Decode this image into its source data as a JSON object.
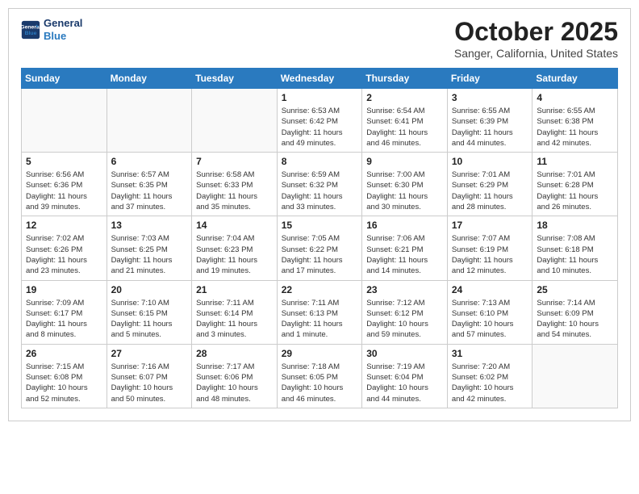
{
  "header": {
    "logo_line1": "General",
    "logo_line2": "Blue",
    "month": "October 2025",
    "location": "Sanger, California, United States"
  },
  "weekdays": [
    "Sunday",
    "Monday",
    "Tuesday",
    "Wednesday",
    "Thursday",
    "Friday",
    "Saturday"
  ],
  "weeks": [
    [
      {
        "day": "",
        "info": ""
      },
      {
        "day": "",
        "info": ""
      },
      {
        "day": "",
        "info": ""
      },
      {
        "day": "1",
        "info": "Sunrise: 6:53 AM\nSunset: 6:42 PM\nDaylight: 11 hours\nand 49 minutes."
      },
      {
        "day": "2",
        "info": "Sunrise: 6:54 AM\nSunset: 6:41 PM\nDaylight: 11 hours\nand 46 minutes."
      },
      {
        "day": "3",
        "info": "Sunrise: 6:55 AM\nSunset: 6:39 PM\nDaylight: 11 hours\nand 44 minutes."
      },
      {
        "day": "4",
        "info": "Sunrise: 6:55 AM\nSunset: 6:38 PM\nDaylight: 11 hours\nand 42 minutes."
      }
    ],
    [
      {
        "day": "5",
        "info": "Sunrise: 6:56 AM\nSunset: 6:36 PM\nDaylight: 11 hours\nand 39 minutes."
      },
      {
        "day": "6",
        "info": "Sunrise: 6:57 AM\nSunset: 6:35 PM\nDaylight: 11 hours\nand 37 minutes."
      },
      {
        "day": "7",
        "info": "Sunrise: 6:58 AM\nSunset: 6:33 PM\nDaylight: 11 hours\nand 35 minutes."
      },
      {
        "day": "8",
        "info": "Sunrise: 6:59 AM\nSunset: 6:32 PM\nDaylight: 11 hours\nand 33 minutes."
      },
      {
        "day": "9",
        "info": "Sunrise: 7:00 AM\nSunset: 6:30 PM\nDaylight: 11 hours\nand 30 minutes."
      },
      {
        "day": "10",
        "info": "Sunrise: 7:01 AM\nSunset: 6:29 PM\nDaylight: 11 hours\nand 28 minutes."
      },
      {
        "day": "11",
        "info": "Sunrise: 7:01 AM\nSunset: 6:28 PM\nDaylight: 11 hours\nand 26 minutes."
      }
    ],
    [
      {
        "day": "12",
        "info": "Sunrise: 7:02 AM\nSunset: 6:26 PM\nDaylight: 11 hours\nand 23 minutes."
      },
      {
        "day": "13",
        "info": "Sunrise: 7:03 AM\nSunset: 6:25 PM\nDaylight: 11 hours\nand 21 minutes."
      },
      {
        "day": "14",
        "info": "Sunrise: 7:04 AM\nSunset: 6:23 PM\nDaylight: 11 hours\nand 19 minutes."
      },
      {
        "day": "15",
        "info": "Sunrise: 7:05 AM\nSunset: 6:22 PM\nDaylight: 11 hours\nand 17 minutes."
      },
      {
        "day": "16",
        "info": "Sunrise: 7:06 AM\nSunset: 6:21 PM\nDaylight: 11 hours\nand 14 minutes."
      },
      {
        "day": "17",
        "info": "Sunrise: 7:07 AM\nSunset: 6:19 PM\nDaylight: 11 hours\nand 12 minutes."
      },
      {
        "day": "18",
        "info": "Sunrise: 7:08 AM\nSunset: 6:18 PM\nDaylight: 11 hours\nand 10 minutes."
      }
    ],
    [
      {
        "day": "19",
        "info": "Sunrise: 7:09 AM\nSunset: 6:17 PM\nDaylight: 11 hours\nand 8 minutes."
      },
      {
        "day": "20",
        "info": "Sunrise: 7:10 AM\nSunset: 6:15 PM\nDaylight: 11 hours\nand 5 minutes."
      },
      {
        "day": "21",
        "info": "Sunrise: 7:11 AM\nSunset: 6:14 PM\nDaylight: 11 hours\nand 3 minutes."
      },
      {
        "day": "22",
        "info": "Sunrise: 7:11 AM\nSunset: 6:13 PM\nDaylight: 11 hours\nand 1 minute."
      },
      {
        "day": "23",
        "info": "Sunrise: 7:12 AM\nSunset: 6:12 PM\nDaylight: 10 hours\nand 59 minutes."
      },
      {
        "day": "24",
        "info": "Sunrise: 7:13 AM\nSunset: 6:10 PM\nDaylight: 10 hours\nand 57 minutes."
      },
      {
        "day": "25",
        "info": "Sunrise: 7:14 AM\nSunset: 6:09 PM\nDaylight: 10 hours\nand 54 minutes."
      }
    ],
    [
      {
        "day": "26",
        "info": "Sunrise: 7:15 AM\nSunset: 6:08 PM\nDaylight: 10 hours\nand 52 minutes."
      },
      {
        "day": "27",
        "info": "Sunrise: 7:16 AM\nSunset: 6:07 PM\nDaylight: 10 hours\nand 50 minutes."
      },
      {
        "day": "28",
        "info": "Sunrise: 7:17 AM\nSunset: 6:06 PM\nDaylight: 10 hours\nand 48 minutes."
      },
      {
        "day": "29",
        "info": "Sunrise: 7:18 AM\nSunset: 6:05 PM\nDaylight: 10 hours\nand 46 minutes."
      },
      {
        "day": "30",
        "info": "Sunrise: 7:19 AM\nSunset: 6:04 PM\nDaylight: 10 hours\nand 44 minutes."
      },
      {
        "day": "31",
        "info": "Sunrise: 7:20 AM\nSunset: 6:02 PM\nDaylight: 10 hours\nand 42 minutes."
      },
      {
        "day": "",
        "info": ""
      }
    ]
  ]
}
